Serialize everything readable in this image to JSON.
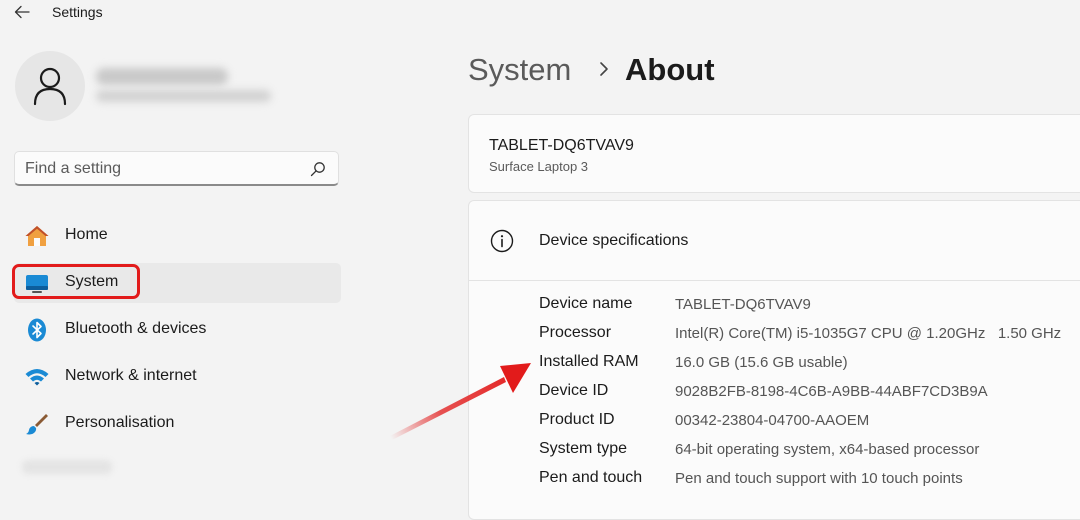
{
  "app": {
    "title": "Settings"
  },
  "search": {
    "placeholder": "Find a setting"
  },
  "nav": {
    "items": [
      {
        "label": "Home",
        "icon": "home-icon"
      },
      {
        "label": "System",
        "icon": "system-icon",
        "selected": true
      },
      {
        "label": "Bluetooth & devices",
        "icon": "bluetooth-icon"
      },
      {
        "label": "Network & internet",
        "icon": "wifi-icon"
      },
      {
        "label": "Personalisation",
        "icon": "brush-icon"
      }
    ]
  },
  "breadcrumb": {
    "parent": "System",
    "current": "About"
  },
  "device": {
    "name": "TABLET-DQ6TVAV9",
    "model": "Surface Laptop 3"
  },
  "specs": {
    "title": "Device specifications",
    "rows": [
      {
        "label": "Device name",
        "value": "TABLET-DQ6TVAV9"
      },
      {
        "label": "Processor",
        "value": "Intel(R) Core(TM) i5-1035G7 CPU @ 1.20GHz   1.50 GHz"
      },
      {
        "label": "Installed RAM",
        "value": "16.0 GB (15.6 GB usable)"
      },
      {
        "label": "Device ID",
        "value": "9028B2FB-8198-4C6B-A9BB-44ABF7CD3B9A"
      },
      {
        "label": "Product ID",
        "value": "00342-23804-04700-AAOEM"
      },
      {
        "label": "System type",
        "value": "64-bit operating system, x64-based processor"
      },
      {
        "label": "Pen and touch",
        "value": "Pen and touch support with 10 touch points"
      }
    ]
  },
  "colors": {
    "annotation": "#e21b1b",
    "accent": "#0067c0"
  }
}
